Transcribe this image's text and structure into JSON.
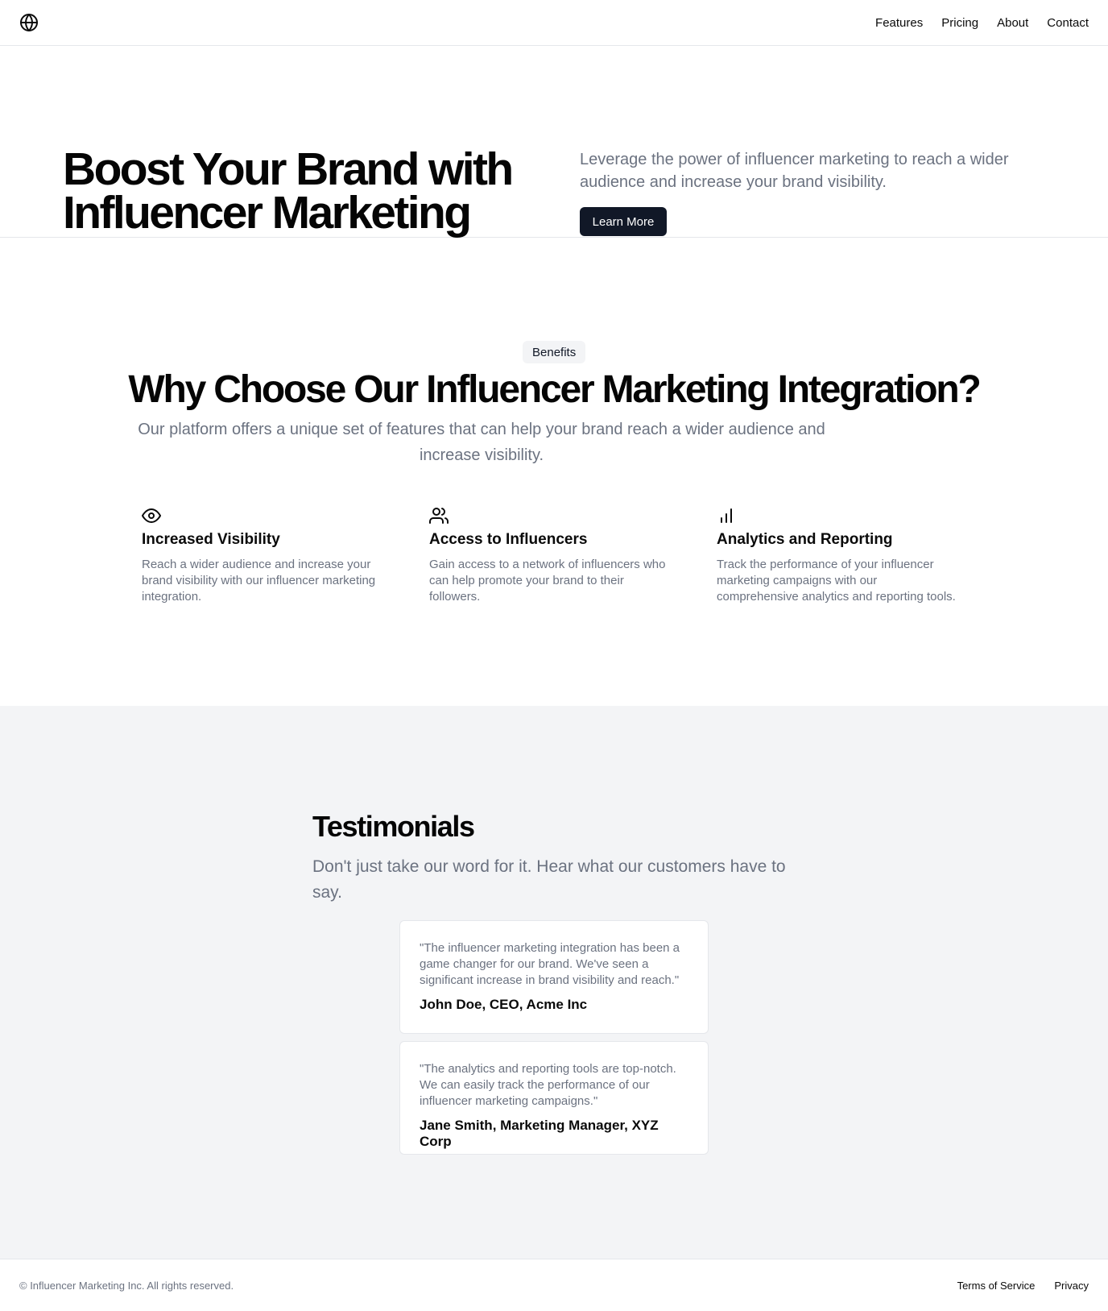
{
  "header": {
    "logo_icon": "globe-icon",
    "nav": [
      "Features",
      "Pricing",
      "About",
      "Contact"
    ]
  },
  "hero": {
    "title": "Boost Your Brand with Influencer Marketing",
    "subtitle": "Leverage the power of influencer marketing to reach a wider audience and increase your brand visibility.",
    "cta_label": "Learn More"
  },
  "benefits": {
    "badge": "Benefits",
    "title": "Why Choose Our Influencer Marketing Integration?",
    "subtitle": "Our platform offers a unique set of features that can help your brand reach a wider audience and increase visibility.",
    "features": [
      {
        "icon": "eye-icon",
        "title": "Increased Visibility",
        "text": "Reach a wider audience and increase your brand visibility with our influencer marketing integration."
      },
      {
        "icon": "users-icon",
        "title": "Access to Influencers",
        "text": "Gain access to a network of influencers who can help promote your brand to their followers."
      },
      {
        "icon": "bar-chart-icon",
        "title": "Analytics and Reporting",
        "text": "Track the performance of your influencer marketing campaigns with our comprehensive analytics and reporting tools."
      }
    ]
  },
  "testimonials": {
    "title": "Testimonials",
    "subtitle": "Don't just take our word for it. Hear what our customers have to say.",
    "items": [
      {
        "quote": "\"The influencer marketing integration has been a game changer for our brand. We've seen a significant increase in brand visibility and reach.\"",
        "author": "John Doe, CEO, Acme Inc"
      },
      {
        "quote": "\"The analytics and reporting tools are top-notch. We can easily track the performance of our influencer marketing campaigns.\"",
        "author": "Jane Smith, Marketing Manager, XYZ Corp"
      }
    ]
  },
  "footer": {
    "copyright": "© Influencer Marketing Inc. All rights reserved.",
    "links": [
      "Terms of Service",
      "Privacy"
    ]
  }
}
